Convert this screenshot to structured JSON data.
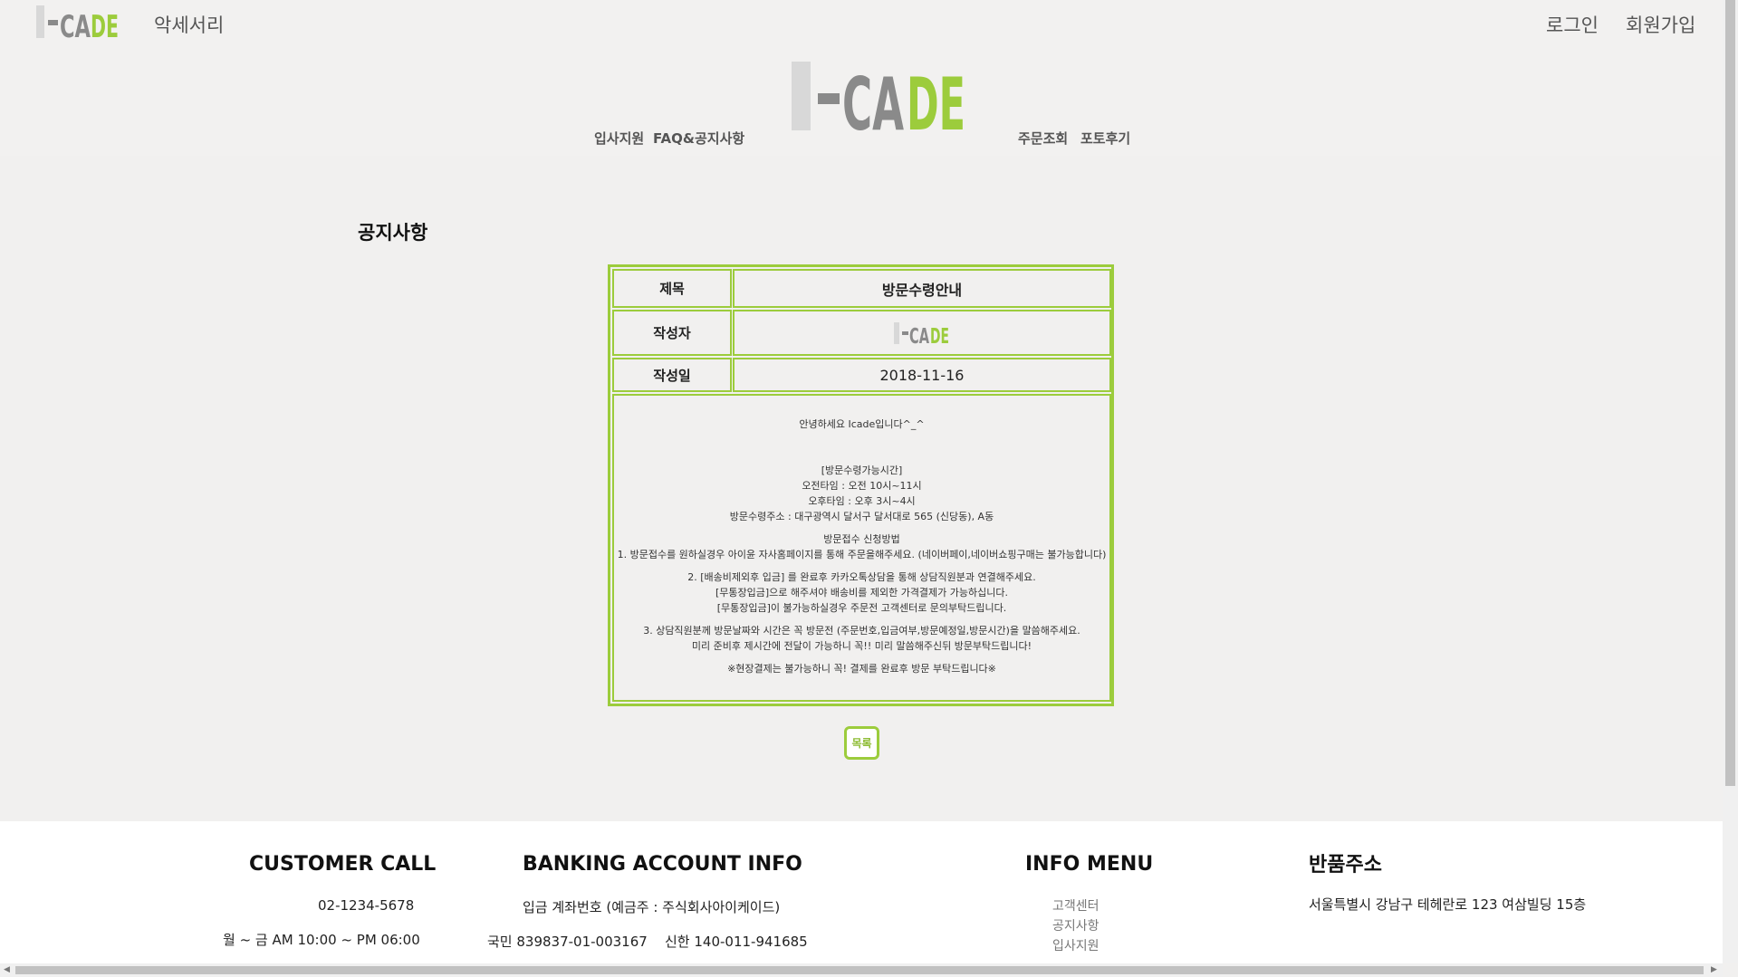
{
  "header": {
    "logo_text": "I-CADE",
    "category": "악세서리",
    "login": "로그인",
    "signup": "회원가입",
    "nav": [
      "입사지원",
      "FAQ&공지사항",
      "주문조회",
      "포토후기"
    ]
  },
  "content": {
    "page_title": "공지사항",
    "labels": {
      "title": "제목",
      "author": "작성자",
      "date": "작성일"
    },
    "title_value": "방문수령안내",
    "author_logo": "I-CADE",
    "date_value": "2018-11-16",
    "body_lines": [
      "안녕하세요 Icade입니다^_^",
      "",
      "",
      "[방문수령가능시간]",
      "오전타임 : 오전 10시~11시",
      "오후타임 : 오후 3시~4시",
      "방문수령주소 : 대구광역시 달서구 달서대로 565 (신당동), A동",
      "",
      "방문접수 신청방법",
      "1. 방문접수를 원하실경우 아이윤 자사홈페이지를 통해 주문을해주세요. (네이버페이,네이버쇼핑구매는 불가능합니다)",
      "",
      "2. [배송비제외후 입금] 를 완료후 카카오톡상담을 통해 상담직원분과 연결해주세요.",
      "[무통장입금]으로 해주셔야 배송비를 제외한 가격결제가 가능하십니다.",
      "[무통장입금]이 불가능하실경우 주문전 고객센터로 문의부탁드립니다.",
      "",
      "3. 상담직원분께 방문날짜와 시간은 꼭 방문전 (주문번호,입금여부,방문예정일,방문시간)을 말씀해주세요.",
      "미리 준비후 제시간에 전달이 가능하니 꼭!! 미리 말씀해주신뒤 방문부탁드립니다!",
      "",
      "※현장결제는 불가능하니 꼭! 결제를 완료후 방문 부탁드립니다※"
    ],
    "list_button": "목록"
  },
  "footer": {
    "customer_call": {
      "heading": "CUSTOMER CALL",
      "phone": "02-1234-5678",
      "hours": "월 ~ 금 AM 10:00 ~ PM 06:00"
    },
    "banking": {
      "heading": "BANKING ACCOUNT INFO",
      "holder": "입금 계좌번호 (예금주 : 주식회사아이케이드)",
      "kb": "국민 839837-01-003167",
      "shinhan": "신한 140-011-941685"
    },
    "info_menu": {
      "heading": "INFO MENU",
      "items": [
        "고객센터",
        "공지사항",
        "입사지원"
      ]
    },
    "return_address": {
      "heading": "반품주소",
      "address": "서울특별시 강남구 테헤란로 123 여삼빌딩 15층"
    }
  },
  "colors": {
    "accent": "#9ccc3c",
    "logo_gray": "#8a8a8a",
    "logo_light": "#d8d8d8",
    "background": "#f1f0ef"
  }
}
